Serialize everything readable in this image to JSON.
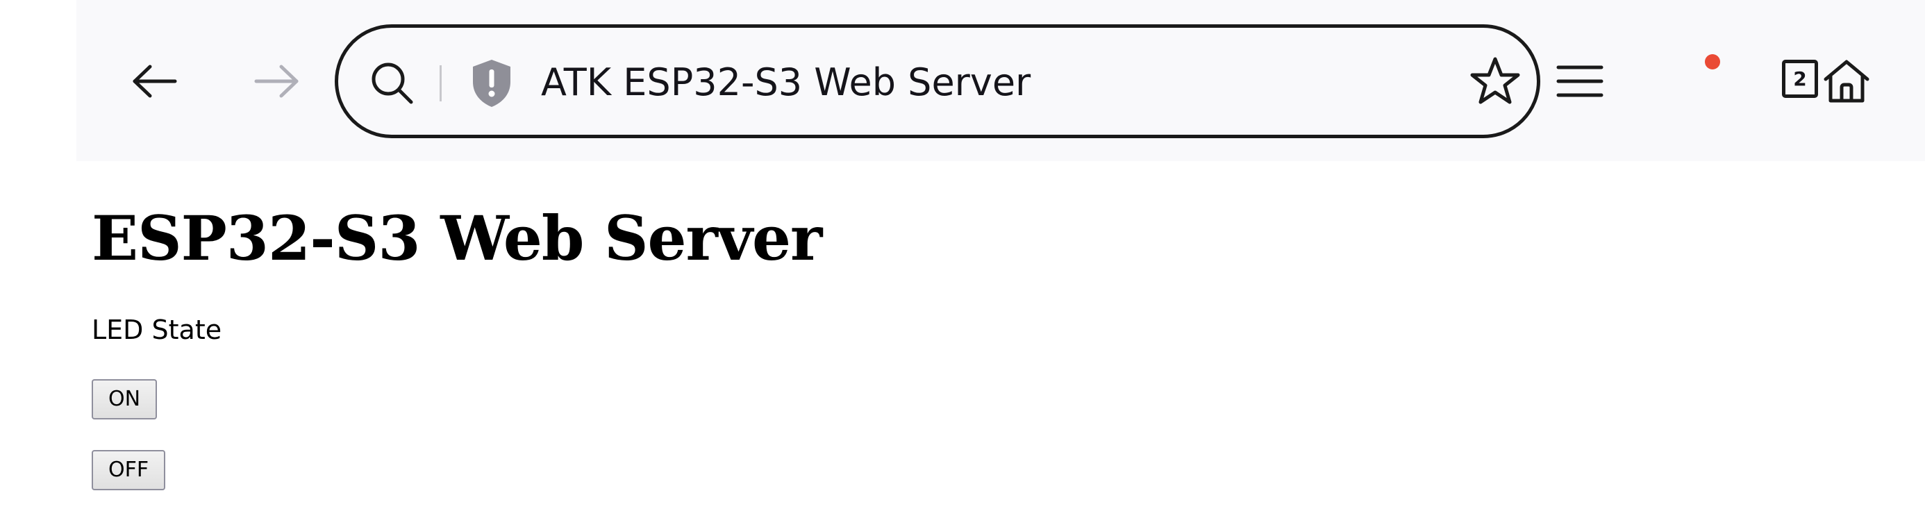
{
  "browser": {
    "address_text": "ATK ESP32-S3 Web Server",
    "tab_count": "2",
    "colors": {
      "toolbar_bg": "#f9f9fb",
      "notification_dot": "#ea4a35",
      "forward_disabled": "#b0b0b8"
    },
    "icons": {
      "back": "arrow-left-icon",
      "forward": "arrow-right-icon",
      "search": "search-icon",
      "site_info": "shield-warning-icon",
      "bookmark": "star-icon",
      "menu": "hamburger-menu-icon",
      "home": "home-icon"
    }
  },
  "page": {
    "title": "ESP32-S3 Web Server",
    "led_label": "LED State",
    "on_label": "ON",
    "off_label": "OFF"
  }
}
